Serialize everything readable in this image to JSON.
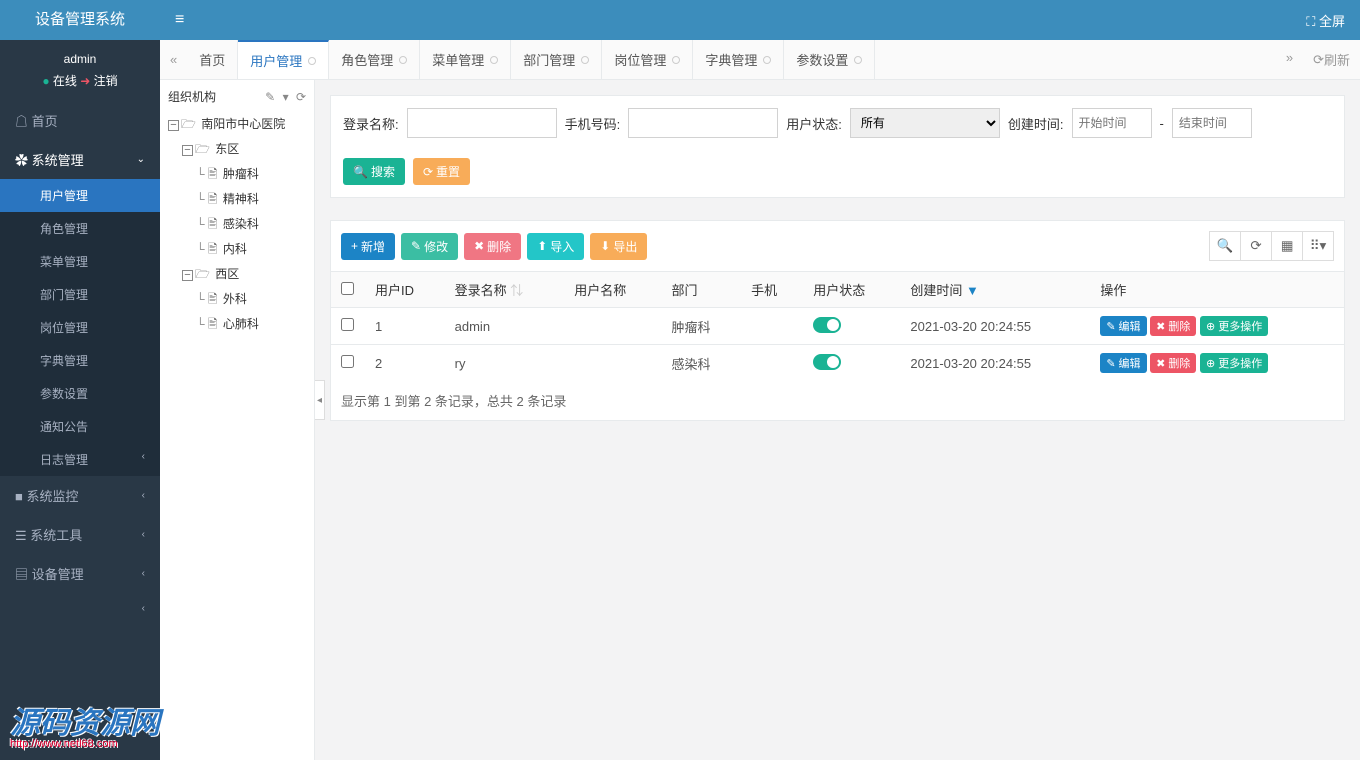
{
  "header": {
    "app_title": "设备管理系统",
    "fullscreen": "全屏"
  },
  "user": {
    "name": "admin",
    "online": "在线",
    "logout": "注销"
  },
  "nav": {
    "home": "首页",
    "sysmgmt": "系统管理",
    "items": {
      "user": "用户管理",
      "role": "角色管理",
      "menu": "菜单管理",
      "dept": "部门管理",
      "post": "岗位管理",
      "dict": "字典管理",
      "param": "参数设置",
      "notice": "通知公告",
      "log": "日志管理"
    },
    "monitor": "系统监控",
    "tool": "系统工具",
    "device": "设备管理"
  },
  "tabs": {
    "home": "首页",
    "user": "用户管理",
    "role": "角色管理",
    "menu": "菜单管理",
    "dept": "部门管理",
    "post": "岗位管理",
    "dict": "字典管理",
    "param": "参数设置",
    "refresh": "刷新"
  },
  "tree": {
    "title": "组织机构",
    "root": "南阳市中心医院",
    "east": "东区",
    "west": "西区",
    "nodes": {
      "oncology": "肿瘤科",
      "psych": "精神科",
      "infect": "感染科",
      "internal": "内科",
      "surgery": "外科",
      "cardio": "心肺科"
    }
  },
  "search": {
    "login_name": "登录名称:",
    "phone": "手机号码:",
    "status": "用户状态:",
    "status_all": "所有",
    "create_time": "创建时间:",
    "start_ph": "开始时间",
    "end_ph": "结束时间",
    "search_btn": "搜索",
    "reset_btn": "重置"
  },
  "toolbar": {
    "add": "新增",
    "edit": "修改",
    "delete": "删除",
    "import": "导入",
    "export": "导出"
  },
  "columns": {
    "uid": "用户ID",
    "login": "登录名称",
    "uname": "用户名称",
    "dept": "部门",
    "phone": "手机",
    "status": "用户状态",
    "ctime": "创建时间",
    "ops": "操作"
  },
  "rows": [
    {
      "id": "1",
      "login": "admin",
      "uname": "",
      "dept": "肿瘤科",
      "phone": "",
      "ctime": "2021-03-20 20:24:55"
    },
    {
      "id": "2",
      "login": "ry",
      "uname": "",
      "dept": "感染科",
      "phone": "",
      "ctime": "2021-03-20 20:24:55"
    }
  ],
  "ops": {
    "edit": "编辑",
    "del": "删除",
    "more": "更多操作"
  },
  "footer": {
    "text": "显示第 1 到第 2 条记录，总共 2 条记录"
  },
  "watermark": {
    "main": "源码资源网",
    "sub": "http://www.netl68.com"
  }
}
